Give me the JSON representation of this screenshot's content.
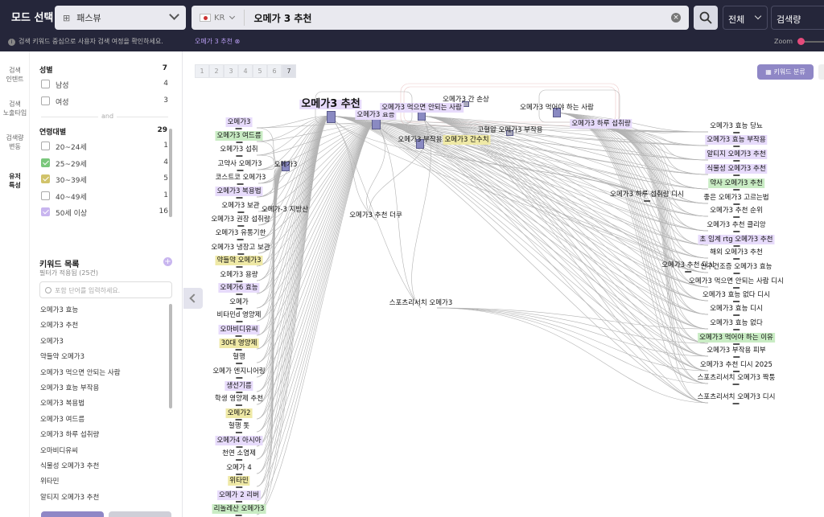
{
  "header": {
    "brand": "모드 선택",
    "mode": "패스뷰",
    "country": "KR",
    "query": "오메가 3 추천",
    "scope": "전체",
    "metric": "검색량"
  },
  "subbar": {
    "hint": "검색 키워드 중심으로 사용자 검색 여정을 확인하세요.",
    "query_tag": "오메가 3 추천 ⊗",
    "zoom_label": "Zoom"
  },
  "rail": [
    "검색\n인텐트",
    "검색\n노출타입",
    "검색량\n변동",
    "유저\n특성"
  ],
  "filters": {
    "gender": {
      "title": "성별",
      "count": "7",
      "items": [
        {
          "label": "남성",
          "count": "4",
          "state": ""
        },
        {
          "label": "여성",
          "count": "3",
          "state": ""
        }
      ]
    },
    "and": "and",
    "age": {
      "title": "연령대별",
      "count": "29",
      "items": [
        {
          "label": "20~24세",
          "count": "1",
          "state": ""
        },
        {
          "label": "25~29세",
          "count": "4",
          "state": "on"
        },
        {
          "label": "30~39세",
          "count": "5",
          "state": "on2"
        },
        {
          "label": "40~49세",
          "count": "1",
          "state": ""
        },
        {
          "label": "50세 이상",
          "count": "16",
          "state": "on3"
        }
      ]
    }
  },
  "keywords": {
    "title": "키워드 목록",
    "subtitle": "필터가 적용됨 (25건)",
    "placeholder": "포함 단어를 입력하세요.",
    "items": [
      "오메가3 효능",
      "오메가3 추천",
      "오메가3",
      "약들약 오메가3",
      "오메가3 먹으면 안되는 사람",
      "오메가3 효능 부작용",
      "오메가3 복용법",
      "오메가3 여드름",
      "오메가3 하루 섭취량",
      "오마비디유씨",
      "식물성 오메가3 추천",
      "위타민",
      "알티지 오메가3 추천"
    ]
  },
  "canvas": {
    "pages": [
      "1",
      "2",
      "3",
      "4",
      "5",
      "6",
      "7"
    ],
    "current_page": "7",
    "kw_button": "키워드 분류"
  },
  "graph": {
    "nodes": [
      {
        "label": "오메가3 추천",
        "cls": "b"
      },
      {
        "label": "오메가3 효능",
        "cls": "p"
      },
      {
        "label": "오메가3 먹으면 안되는 사람",
        "cls": "p"
      },
      {
        "label": "오메가3 간 손상",
        "cls": ""
      },
      {
        "label": "오메가3 먹어야 하는 사람",
        "cls": ""
      },
      {
        "label": "오메가3 하루 섭취량",
        "cls": "p"
      },
      {
        "label": "고혈압 오메가3 부작용",
        "cls": ""
      },
      {
        "label": "오메가3 부작용",
        "cls": ""
      },
      {
        "label": "오메가3 간수치",
        "cls": "y"
      },
      {
        "label": "오메가3",
        "cls": ""
      },
      {
        "label": "오메가-3 지방산",
        "cls": ""
      },
      {
        "label": "오메가3 추천 더쿠",
        "cls": ""
      },
      {
        "label": "스포츠리서치 오메가3",
        "cls": ""
      },
      {
        "label": "오메가3 하루 섭취량 디시",
        "cls": ""
      },
      {
        "label": "오메가3 추천 디시",
        "cls": ""
      },
      {
        "label": "오메가3",
        "cls": "p"
      },
      {
        "label": "오메가3 여드름",
        "cls": "g"
      },
      {
        "label": "오메가3 섭취",
        "cls": ""
      },
      {
        "label": "고약사 오메가3",
        "cls": ""
      },
      {
        "label": "코스트코 오메가3",
        "cls": ""
      },
      {
        "label": "오메가3 복용법",
        "cls": "p"
      },
      {
        "label": "오메가3 보관",
        "cls": ""
      },
      {
        "label": "오메가3 권장 섭취량",
        "cls": ""
      },
      {
        "label": "오메가3 유통기한",
        "cls": ""
      },
      {
        "label": "오메가3 냉장고 보관",
        "cls": ""
      },
      {
        "label": "약들약 오메가3",
        "cls": "y"
      },
      {
        "label": "오메가3 용량",
        "cls": ""
      },
      {
        "label": "오메가6 효능",
        "cls": "p"
      },
      {
        "label": "오메가",
        "cls": ""
      },
      {
        "label": "비타민d 영양제",
        "cls": ""
      },
      {
        "label": "오마비디유씨",
        "cls": "p"
      },
      {
        "label": "30대 영양제",
        "cls": "y"
      },
      {
        "label": "혈행",
        "cls": ""
      },
      {
        "label": "오메가 엔지니어링",
        "cls": ""
      },
      {
        "label": "생선기름",
        "cls": "p"
      },
      {
        "label": "학생 영양제 추천",
        "cls": ""
      },
      {
        "label": "오메가2",
        "cls": "y"
      },
      {
        "label": "혈행 톳",
        "cls": ""
      },
      {
        "label": "오메가4 아시아",
        "cls": "p"
      },
      {
        "label": "천연 소염제",
        "cls": ""
      },
      {
        "label": "오메가 4",
        "cls": ""
      },
      {
        "label": "위타민",
        "cls": "y"
      },
      {
        "label": "오메가 2 리버",
        "cls": "p"
      },
      {
        "label": "리놀레산 오메가3",
        "cls": "g"
      },
      {
        "label": "오메가3 효능 당뇨",
        "cls": ""
      },
      {
        "label": "오메가3 효능 부작용",
        "cls": "p"
      },
      {
        "label": "알티지 오메가3 추천",
        "cls": "p"
      },
      {
        "label": "식물성 오메가3 추천",
        "cls": "p"
      },
      {
        "label": "약사 오메가3 추천",
        "cls": "g"
      },
      {
        "label": "좋은 오메가3 고르는법",
        "cls": ""
      },
      {
        "label": "오메가3 추천 순위",
        "cls": ""
      },
      {
        "label": "오메가3 추천 클리앙",
        "cls": ""
      },
      {
        "label": "초 임계 rtg 오메가3 추천",
        "cls": "p"
      },
      {
        "label": "해외 오메가3 추천",
        "cls": ""
      },
      {
        "label": "안구건조증 오메가3 효능",
        "cls": ""
      },
      {
        "label": "오메가3 먹으면 안되는 사람 디시",
        "cls": ""
      },
      {
        "label": "오메가3 효능 없다 디시",
        "cls": ""
      },
      {
        "label": "오메가3 효능 디시",
        "cls": ""
      },
      {
        "label": "오메가3 효능 없다",
        "cls": ""
      },
      {
        "label": "오메가3 먹어야 하는 이유",
        "cls": "g"
      },
      {
        "label": "오메가3 부작용 피부",
        "cls": ""
      },
      {
        "label": "오메가3 추천 디시 2025",
        "cls": ""
      },
      {
        "label": "스포츠리서치 오메가3 짝퉁",
        "cls": ""
      },
      {
        "label": "스포츠리서치 오메가3 디시",
        "cls": ""
      }
    ]
  },
  "colors": {
    "header": "#25263a",
    "accent": "#8f87c6",
    "purple_tag": "#e7dbfb",
    "green_tag": "#c9ecc4",
    "yellow_tag": "#efe9a6",
    "zoom": "#e54b7b"
  }
}
